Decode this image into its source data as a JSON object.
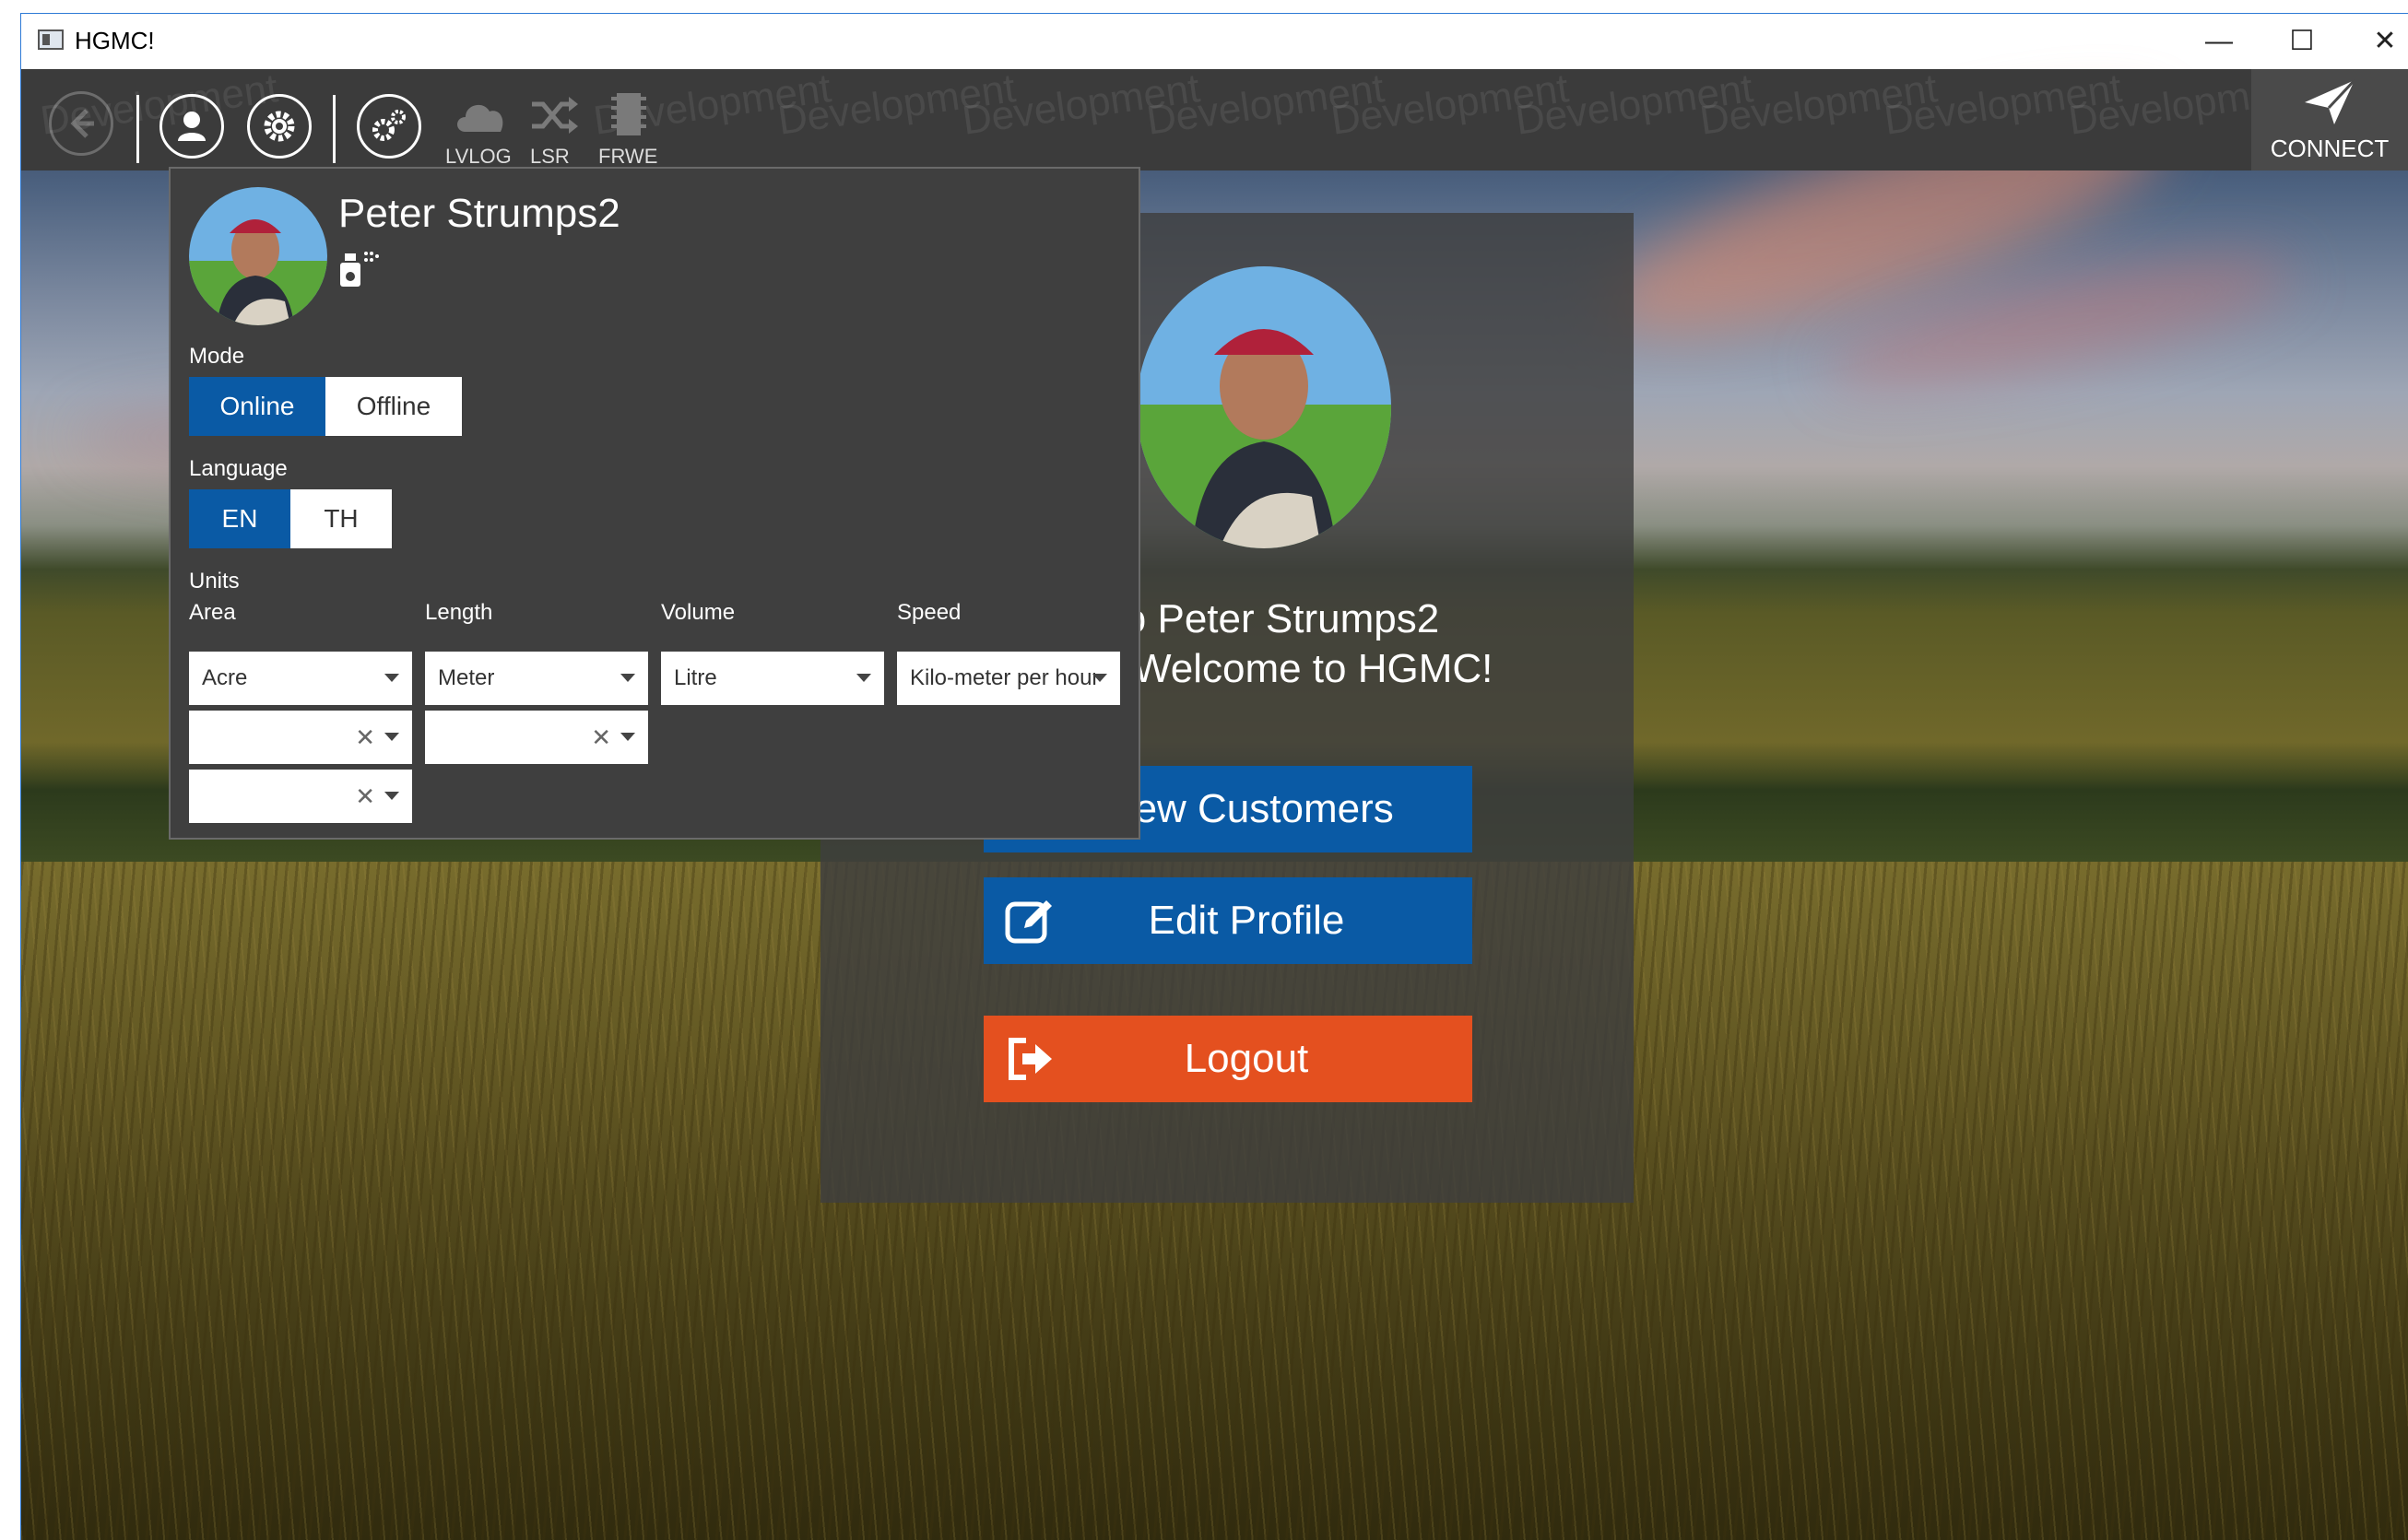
{
  "window": {
    "title": "HGMC!",
    "minimize_glyph": "—",
    "maximize_glyph": "☐",
    "close_glyph": "✕"
  },
  "toolbar": {
    "watermark_text": "Development",
    "tools": [
      {
        "label": "LVLOG",
        "icon": "cloud-icon"
      },
      {
        "label": "LSR",
        "icon": "shuffle-icon"
      },
      {
        "label": "FRWE",
        "icon": "chip-icon"
      }
    ],
    "connect_label": "CONNECT",
    "icons": [
      "back-icon",
      "user-icon",
      "settings-icon",
      "advanced-settings-icon",
      "send-icon"
    ]
  },
  "home": {
    "hello_text": "Hello Peter Strumps2",
    "welcome_text": "Welcome to HGMC!",
    "view_customers_label": "View Customers",
    "edit_profile_label": "Edit Profile",
    "logout_label": "Logout"
  },
  "profile_panel": {
    "user_name": "Peter Strumps2",
    "mode_label": "Mode",
    "mode_options": {
      "online": "Online",
      "offline": "Offline"
    },
    "mode_selected": "Online",
    "language_label": "Language",
    "language_options": {
      "en": "EN",
      "th": "TH"
    },
    "language_selected": "EN",
    "units_label": "Units",
    "units": {
      "area_label": "Area",
      "length_label": "Length",
      "volume_label": "Volume",
      "speed_label": "Speed",
      "area_value": "Acre",
      "length_value": "Meter",
      "volume_value": "Litre",
      "speed_value": "Kilo-meter per hour"
    },
    "clear_glyph": "✕"
  },
  "colors": {
    "primary_blue": "#0a5aa5",
    "logout_orange": "#e4501f",
    "panel_bg": "#3f3f3f",
    "toolbar_bg": "#3b3b3b"
  }
}
